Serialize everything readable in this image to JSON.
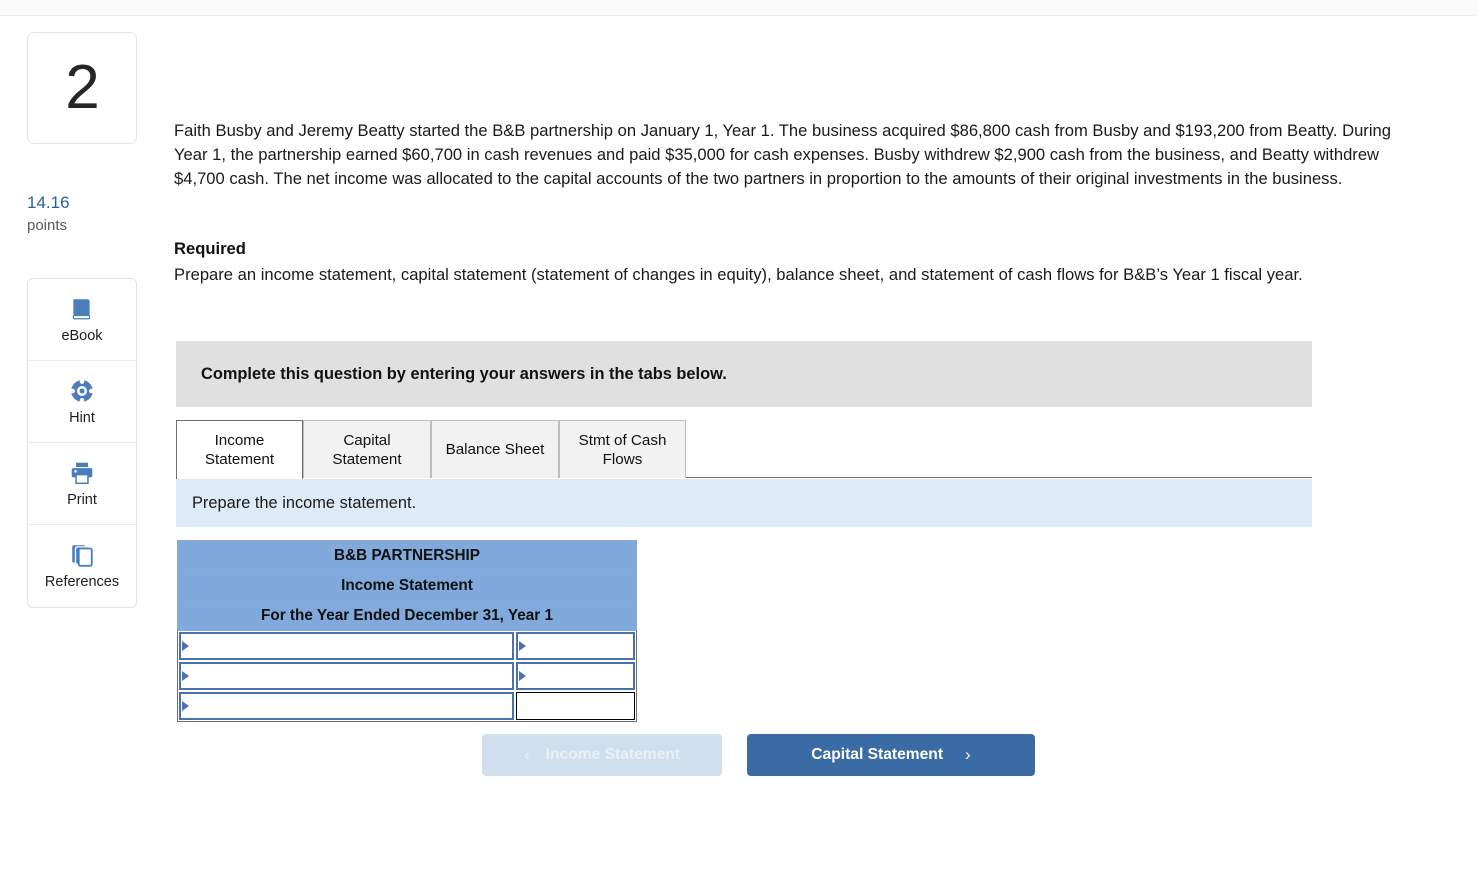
{
  "question": {
    "number": "2",
    "points_value": "14.16",
    "points_label": "points",
    "intro": "Faith Busby and Jeremy Beatty started the B&B partnership on January 1, Year 1. The business acquired $86,800 cash from Busby and $193,200 from Beatty. During Year 1, the partnership earned $60,700 in cash revenues and paid $35,000 for cash expenses. Busby withdrew $2,900 cash from the business, and Beatty withdrew $4,700 cash. The net income was allocated to the capital accounts of the two partners in proportion to the amounts of their original investments in the business.",
    "required_heading": "Required",
    "required_text": "Prepare an income statement, capital statement (statement of changes in equity), balance sheet, and statement of cash flows for B&B’s Year 1 fiscal year."
  },
  "tools": [
    {
      "label": "eBook",
      "icon": "book-icon"
    },
    {
      "label": "Hint",
      "icon": "lifesaver-icon"
    },
    {
      "label": "Print",
      "icon": "printer-icon"
    },
    {
      "label": "References",
      "icon": "pages-icon"
    }
  ],
  "instruction_banner": "Complete this question by entering your answers in the tabs below.",
  "tabs": [
    {
      "label": "Income\nStatement",
      "line1": "Income",
      "line2": "Statement",
      "active": true
    },
    {
      "label": "Capital Statement",
      "line1": "Capital",
      "line2": "Statement",
      "active": false
    },
    {
      "label": "Balance Sheet",
      "line1": "Balance Sheet",
      "line2": "",
      "active": false
    },
    {
      "label": "Stmt of Cash Flows",
      "line1": "Stmt of Cash",
      "line2": "Flows",
      "active": false
    }
  ],
  "sub_banner": "Prepare the income statement.",
  "worksheet": {
    "title_rows": [
      "B&B PARTNERSHIP",
      "Income Statement",
      "For the Year Ended December 31, Year 1"
    ],
    "rows": [
      {
        "label": "",
        "amount": "",
        "label_dropdown": true,
        "amount_dropdown": true
      },
      {
        "label": "",
        "amount": "",
        "label_dropdown": true,
        "amount_dropdown": true
      },
      {
        "label": "",
        "amount": "",
        "label_dropdown": true,
        "amount_dropdown": false
      }
    ]
  },
  "nav": {
    "prev_label": "Income Statement",
    "next_label": "Capital Statement",
    "prev_chevron": "‹",
    "next_chevron": "›",
    "prev_disabled": true
  },
  "colors": {
    "accent_blue": "#3b6ba5",
    "table_header_blue": "#82a9dc",
    "sub_banner_blue": "#ddeaf7",
    "instruction_gray": "#e0e0e0",
    "points_blue": "#2b5c9e"
  }
}
